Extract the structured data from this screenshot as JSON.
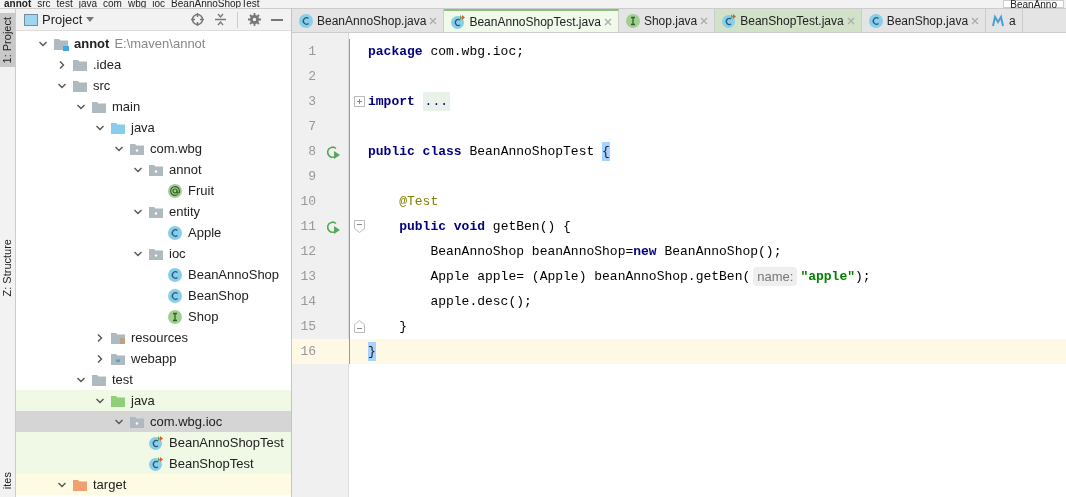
{
  "breadcrumbs": [
    {
      "label": "annot"
    },
    {
      "label": "src"
    },
    {
      "label": "test"
    },
    {
      "label": "java"
    },
    {
      "label": "com"
    },
    {
      "label": "wbg"
    },
    {
      "label": "ioc"
    },
    {
      "label": "BeanAnnoShopTest"
    }
  ],
  "run_config": {
    "label": "BeanAnno"
  },
  "side_tabs": [
    {
      "label": "1: Project",
      "selected": true
    },
    {
      "label": "Z: Structure",
      "selected": false
    },
    {
      "label": "ites",
      "selected": false
    }
  ],
  "project_panel": {
    "title": "Project",
    "tree": [
      {
        "label": "annot",
        "path": "E:\\maven\\annot",
        "kind": "module",
        "expanded": true,
        "selected": false,
        "children": [
          {
            "label": ".idea",
            "kind": "folder",
            "expanded": false,
            "selected": false
          },
          {
            "label": "src",
            "kind": "folder",
            "expanded": true,
            "selected": false,
            "children": [
              {
                "label": "main",
                "kind": "folder",
                "expanded": true,
                "selected": false,
                "children": [
                  {
                    "label": "java",
                    "kind": "source-folder",
                    "expanded": true,
                    "selected": false,
                    "children": [
                      {
                        "label": "com.wbg",
                        "kind": "package",
                        "expanded": true,
                        "selected": false,
                        "children": [
                          {
                            "label": "annot",
                            "kind": "package",
                            "expanded": true,
                            "selected": false,
                            "children": [
                              {
                                "label": "Fruit",
                                "kind": "annotation",
                                "selected": false
                              }
                            ]
                          },
                          {
                            "label": "entity",
                            "kind": "package",
                            "expanded": true,
                            "selected": false,
                            "children": [
                              {
                                "label": "Apple",
                                "kind": "class",
                                "selected": false
                              }
                            ]
                          },
                          {
                            "label": "ioc",
                            "kind": "package",
                            "expanded": true,
                            "selected": false,
                            "children": [
                              {
                                "label": "BeanAnnoShop",
                                "kind": "class",
                                "selected": false
                              },
                              {
                                "label": "BeanShop",
                                "kind": "class",
                                "selected": false
                              },
                              {
                                "label": "Shop",
                                "kind": "interface",
                                "selected": false
                              }
                            ]
                          }
                        ]
                      }
                    ]
                  },
                  {
                    "label": "resources",
                    "kind": "resources-folder",
                    "expanded": false,
                    "selected": false
                  },
                  {
                    "label": "webapp",
                    "kind": "web-folder",
                    "expanded": false,
                    "selected": false
                  }
                ]
              },
              {
                "label": "test",
                "kind": "folder",
                "expanded": true,
                "selected": false,
                "children": [
                  {
                    "label": "java",
                    "kind": "test-folder",
                    "expanded": true,
                    "selected": false,
                    "children": [
                      {
                        "label": "com.wbg.ioc",
                        "kind": "test-package",
                        "expanded": true,
                        "selected": true,
                        "children": [
                          {
                            "label": "BeanAnnoShopTest",
                            "kind": "test-class",
                            "selected": false
                          },
                          {
                            "label": "BeanShopTest",
                            "kind": "test-class",
                            "selected": false
                          }
                        ]
                      }
                    ]
                  }
                ]
              }
            ]
          },
          {
            "label": "target",
            "kind": "excluded-folder",
            "expanded": true,
            "selected": false
          }
        ]
      }
    ]
  },
  "editor": {
    "tabs": [
      {
        "label": "BeanAnnoShop.java",
        "kind": "class",
        "selected": false
      },
      {
        "label": "BeanAnnoShopTest.java",
        "kind": "test-class",
        "selected": true
      },
      {
        "label": "Shop.java",
        "kind": "interface",
        "selected": false
      },
      {
        "label": "BeanShopTest.java",
        "kind": "test-class",
        "selected": false
      },
      {
        "label": "BeanShop.java",
        "kind": "class",
        "selected": false
      },
      {
        "label": "a",
        "kind": "maven",
        "selected": false
      }
    ],
    "lines": [
      {
        "number": "1",
        "tokens": [
          {
            "kind": "keyword",
            "text": "package"
          },
          {
            "kind": "plain",
            "text": " com.wbg.ioc;"
          }
        ]
      },
      {
        "number": "2"
      },
      {
        "number": "3",
        "fold": {
          "kind": "expand"
        },
        "tokens": [
          {
            "kind": "keyword",
            "text": "import "
          },
          {
            "kind": "folded",
            "text": "..."
          }
        ]
      },
      {
        "number": "7"
      },
      {
        "number": "8",
        "run": true,
        "tokens": [
          {
            "kind": "keyword",
            "text": "public class"
          },
          {
            "kind": "plain",
            "text": " BeanAnnoShopTest "
          },
          {
            "kind": "brace",
            "text": "{"
          }
        ]
      },
      {
        "number": "9"
      },
      {
        "number": "10",
        "tokens": [
          {
            "kind": "annotation",
            "text": "    @Test"
          }
        ]
      },
      {
        "number": "11",
        "run": true,
        "fold": {
          "kind": "collapse"
        },
        "tokens": [
          {
            "kind": "keyword",
            "text": "    public void"
          },
          {
            "kind": "plain",
            "text": " getBen() {"
          }
        ]
      },
      {
        "number": "12",
        "tokens": [
          {
            "kind": "plain",
            "text": "        BeanAnnoShop beanAnnoShop="
          },
          {
            "kind": "keyword",
            "text": "new"
          },
          {
            "kind": "plain",
            "text": " BeanAnnoShop();"
          }
        ]
      },
      {
        "number": "13",
        "tokens": [
          {
            "kind": "plain",
            "text": "        Apple apple= (Apple) beanAnnoShop.getBen("
          },
          {
            "kind": "hint",
            "text": "name:"
          },
          {
            "kind": "string",
            "text": "\"apple\""
          },
          {
            "kind": "plain",
            "text": ");"
          }
        ]
      },
      {
        "number": "14",
        "tokens": [
          {
            "kind": "plain",
            "text": "        apple.desc();"
          }
        ]
      },
      {
        "number": "15",
        "fold": {
          "kind": "end"
        },
        "tokens": [
          {
            "kind": "plain",
            "text": "    }"
          }
        ]
      },
      {
        "number": "16",
        "current": true,
        "tokens": [
          {
            "kind": "brace",
            "text": "}"
          }
        ]
      }
    ]
  }
}
